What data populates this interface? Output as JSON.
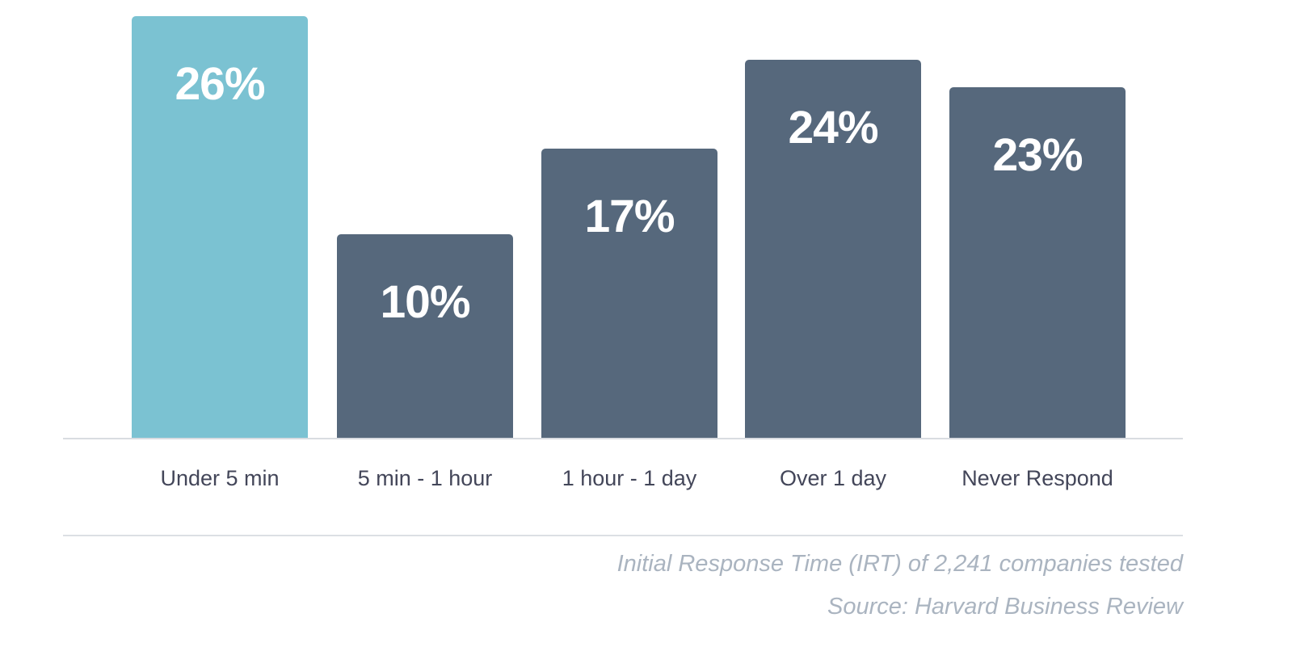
{
  "chart_data": {
    "type": "bar",
    "title": "",
    "subtitle": "",
    "xlabel": "",
    "ylabel": "",
    "categories": [
      "Under 5 min",
      "5 min - 1 hour",
      "1 hour - 1 day",
      "Over 1 day",
      "Never Respond"
    ],
    "values": [
      26,
      10,
      17,
      24,
      23
    ],
    "value_labels": [
      "26%",
      "10%",
      "17%",
      "24%",
      "23%"
    ],
    "value_suffix": "%",
    "ylim": [
      0,
      26
    ],
    "grid": false,
    "legend": null,
    "annotations": [
      "Initial Response Time (IRT) of 2,241 companies tested",
      "Source: Harvard Business Review"
    ],
    "bar_colors": [
      "#7bc2d2",
      "#56687c",
      "#56687c",
      "#56687c",
      "#56687c"
    ],
    "highlight_index": 0,
    "highlight_color": "#7bc2d2",
    "default_bar_color": "#56687c"
  },
  "footer": {
    "note": "Initial Response Time (IRT) of 2,241 companies tested",
    "source": "Source: Harvard Business Review"
  },
  "colors": {
    "accent": "#7bc2d2",
    "bar": "#56687c",
    "label_text": "#434659",
    "footer_text": "#aab4c0",
    "axis_line": "#d9dce1",
    "divider": "#dcdfe4",
    "background": "#ffffff",
    "value_text": "#ffffff"
  }
}
